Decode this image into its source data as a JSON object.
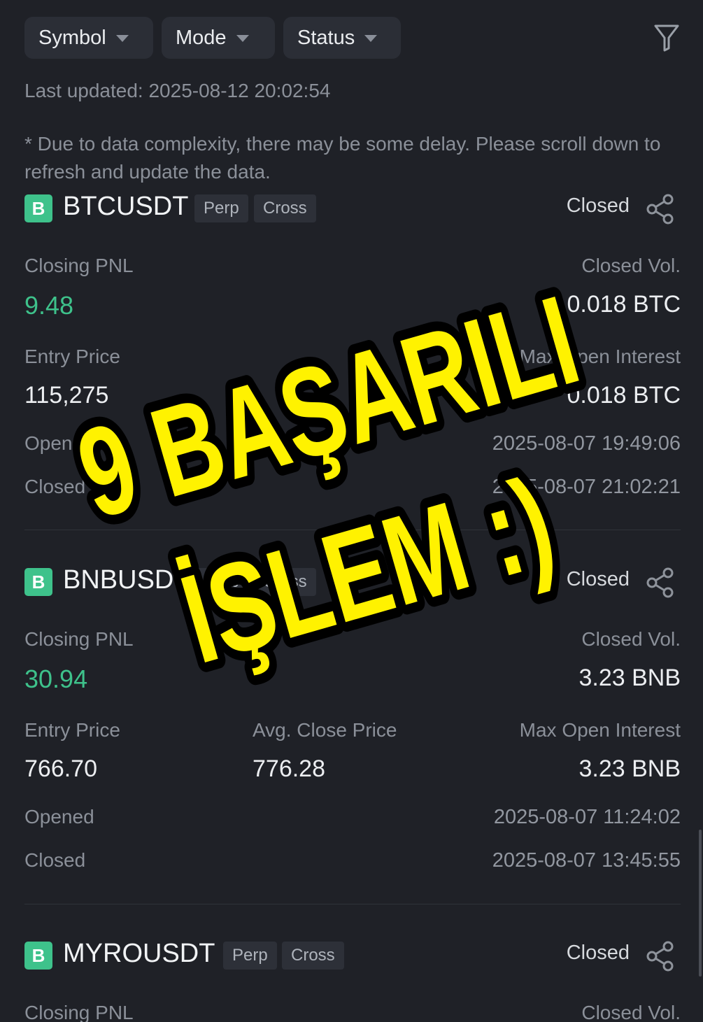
{
  "filters": {
    "symbol_label": "Symbol",
    "mode_label": "Mode",
    "status_label": "Status",
    "filter_icon": "funnel-icon"
  },
  "last_updated": "Last updated: 2025-08-12 20:02:54",
  "disclaimer": "* Due to data complexity, there may be some delay. Please scroll down to refresh and update the data.",
  "positions": [
    {
      "badge": "B",
      "symbol": "BTCUSDT",
      "tags": [
        "Perp",
        "Cross"
      ],
      "status": "Closed",
      "closing_pnl_label": "Closing PNL",
      "closing_pnl": "9.48",
      "closed_vol_label": "Closed Vol.",
      "closed_vol": "0.018 BTC",
      "entry_price_label": "Entry Price",
      "entry_price": "115,275",
      "max_open_interest_label": "Max Open Interest",
      "max_open_interest": "0.018 BTC",
      "opened_label": "Opened",
      "opened": "2025-08-07 19:49:06",
      "closed_label": "Closed",
      "closed": "2025-08-07 21:02:21"
    },
    {
      "badge": "B",
      "symbol": "BNBUSDT",
      "tags": [
        "Perp",
        "Cross"
      ],
      "status": "Closed",
      "closing_pnl_label": "Closing PNL",
      "closing_pnl": "30.94",
      "closed_vol_label": "Closed Vol.",
      "closed_vol": "3.23 BNB",
      "entry_price_label": "Entry Price",
      "entry_price": "766.70",
      "avg_close_price_label": "Avg. Close Price",
      "avg_close_price": "776.28",
      "max_open_interest_label": "Max Open Interest",
      "max_open_interest": "3.23 BNB",
      "opened_label": "Opened",
      "opened": "2025-08-07 11:24:02",
      "closed_label": "Closed",
      "closed": "2025-08-07 13:45:55"
    },
    {
      "badge": "B",
      "symbol": "MYROUSDT",
      "tags": [
        "Perp",
        "Cross"
      ],
      "status": "Closed",
      "closing_pnl_label": "Closing PNL",
      "closed_vol_label": "Closed Vol."
    }
  ],
  "overlay": {
    "line1": "9 BAŞARILI",
    "line2": "İŞLEM :)",
    "fill_color": "#fff200",
    "stroke_color": "#000000"
  },
  "colors": {
    "background": "#1f2127",
    "profit": "#3ec28b",
    "badge": "#3ec28b"
  }
}
